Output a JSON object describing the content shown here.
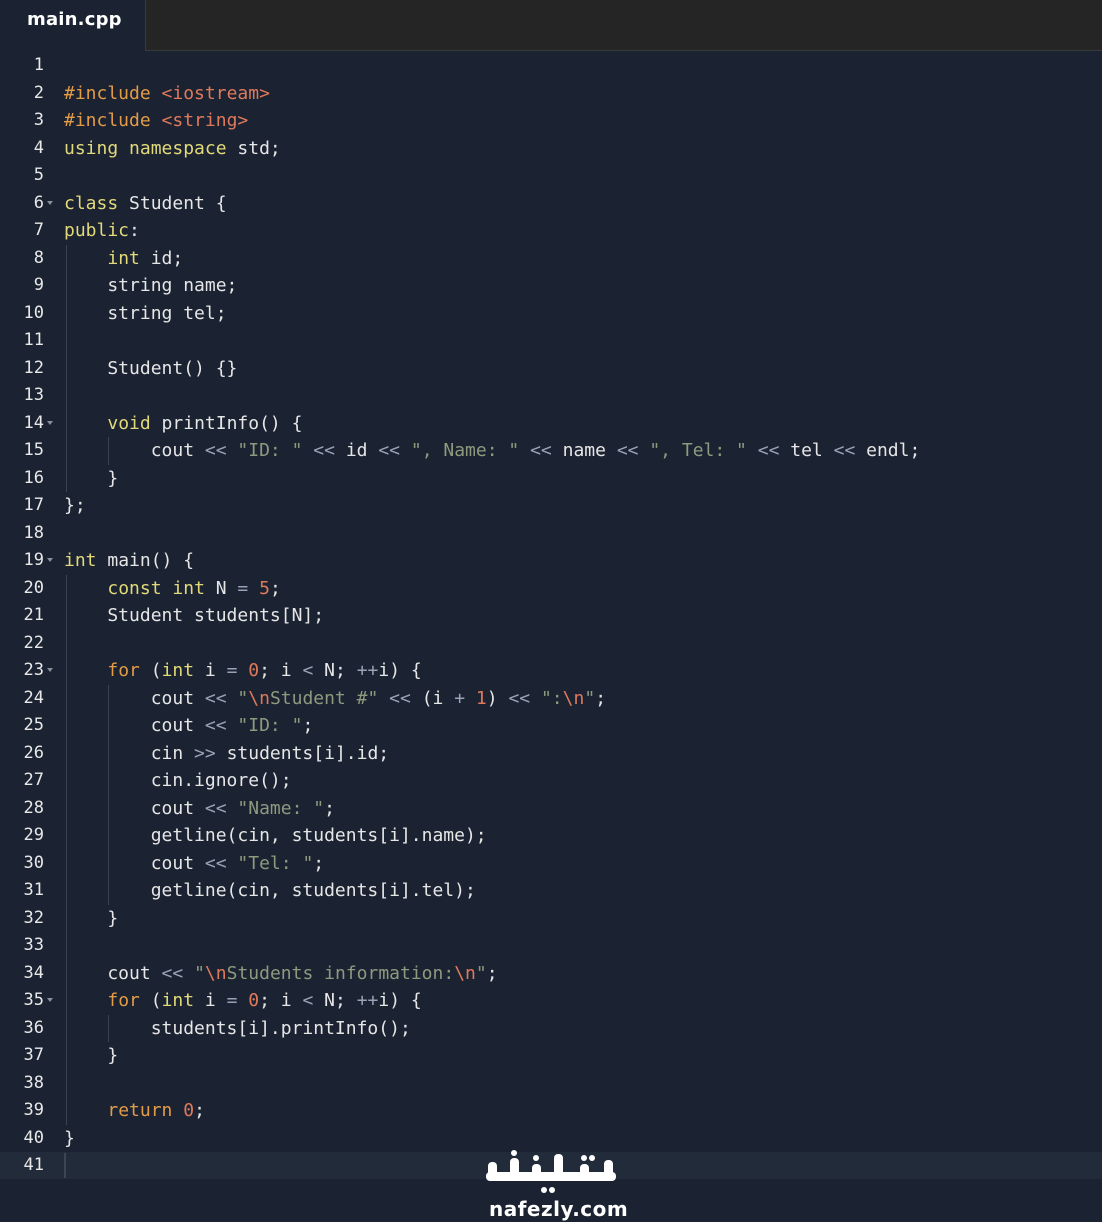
{
  "tab": {
    "filename": "main.cpp"
  },
  "editor": {
    "cursor_line": 41,
    "lines": [
      {
        "n": "1",
        "fold": false,
        "tokens": []
      },
      {
        "n": "2",
        "fold": false,
        "tokens": [
          {
            "c": "inc",
            "t": "#include"
          },
          {
            "c": "id",
            "t": " "
          },
          {
            "c": "hdr",
            "t": "<iostream>"
          }
        ]
      },
      {
        "n": "3",
        "fold": false,
        "tokens": [
          {
            "c": "inc",
            "t": "#include"
          },
          {
            "c": "id",
            "t": " "
          },
          {
            "c": "hdr",
            "t": "<string>"
          }
        ]
      },
      {
        "n": "4",
        "fold": false,
        "tokens": [
          {
            "c": "kw",
            "t": "using"
          },
          {
            "c": "id",
            "t": " "
          },
          {
            "c": "kw",
            "t": "namespace"
          },
          {
            "c": "id",
            "t": " std;"
          }
        ]
      },
      {
        "n": "5",
        "fold": false,
        "tokens": []
      },
      {
        "n": "6",
        "fold": true,
        "tokens": [
          {
            "c": "kw",
            "t": "class"
          },
          {
            "c": "id",
            "t": " Student {"
          }
        ]
      },
      {
        "n": "7",
        "fold": false,
        "tokens": [
          {
            "c": "kw",
            "t": "public"
          },
          {
            "c": "id",
            "t": ":"
          }
        ]
      },
      {
        "n": "8",
        "fold": false,
        "tokens": [
          {
            "c": "id",
            "t": "    "
          },
          {
            "c": "kw",
            "t": "int"
          },
          {
            "c": "id",
            "t": " id;"
          }
        ]
      },
      {
        "n": "9",
        "fold": false,
        "tokens": [
          {
            "c": "id",
            "t": "    string name;"
          }
        ]
      },
      {
        "n": "10",
        "fold": false,
        "tokens": [
          {
            "c": "id",
            "t": "    string tel;"
          }
        ]
      },
      {
        "n": "11",
        "fold": false,
        "tokens": []
      },
      {
        "n": "12",
        "fold": false,
        "tokens": [
          {
            "c": "id",
            "t": "    Student() {}"
          }
        ]
      },
      {
        "n": "13",
        "fold": false,
        "tokens": []
      },
      {
        "n": "14",
        "fold": true,
        "tokens": [
          {
            "c": "id",
            "t": "    "
          },
          {
            "c": "kw",
            "t": "void"
          },
          {
            "c": "id",
            "t": " printInfo() {"
          }
        ]
      },
      {
        "n": "15",
        "fold": false,
        "tokens": [
          {
            "c": "id",
            "t": "        cout "
          },
          {
            "c": "op",
            "t": "<<"
          },
          {
            "c": "id",
            "t": " "
          },
          {
            "c": "str",
            "t": "\"ID: \""
          },
          {
            "c": "id",
            "t": " "
          },
          {
            "c": "op",
            "t": "<<"
          },
          {
            "c": "id",
            "t": " id "
          },
          {
            "c": "op",
            "t": "<<"
          },
          {
            "c": "id",
            "t": " "
          },
          {
            "c": "str",
            "t": "\", Name: \""
          },
          {
            "c": "id",
            "t": " "
          },
          {
            "c": "op",
            "t": "<<"
          },
          {
            "c": "id",
            "t": " name "
          },
          {
            "c": "op",
            "t": "<<"
          },
          {
            "c": "id",
            "t": " "
          },
          {
            "c": "str",
            "t": "\", Tel: \""
          },
          {
            "c": "id",
            "t": " "
          },
          {
            "c": "op",
            "t": "<<"
          },
          {
            "c": "id",
            "t": " tel "
          },
          {
            "c": "op",
            "t": "<<"
          },
          {
            "c": "id",
            "t": " endl;"
          }
        ]
      },
      {
        "n": "16",
        "fold": false,
        "tokens": [
          {
            "c": "id",
            "t": "    }"
          }
        ]
      },
      {
        "n": "17",
        "fold": false,
        "tokens": [
          {
            "c": "id",
            "t": "};"
          }
        ]
      },
      {
        "n": "18",
        "fold": false,
        "tokens": []
      },
      {
        "n": "19",
        "fold": true,
        "tokens": [
          {
            "c": "kw",
            "t": "int"
          },
          {
            "c": "id",
            "t": " main() {"
          }
        ]
      },
      {
        "n": "20",
        "fold": false,
        "tokens": [
          {
            "c": "id",
            "t": "    "
          },
          {
            "c": "kw",
            "t": "const"
          },
          {
            "c": "id",
            "t": " "
          },
          {
            "c": "kw",
            "t": "int"
          },
          {
            "c": "id",
            "t": " N "
          },
          {
            "c": "op",
            "t": "="
          },
          {
            "c": "id",
            "t": " "
          },
          {
            "c": "num",
            "t": "5"
          },
          {
            "c": "id",
            "t": ";"
          }
        ]
      },
      {
        "n": "21",
        "fold": false,
        "tokens": [
          {
            "c": "id",
            "t": "    Student students[N];"
          }
        ]
      },
      {
        "n": "22",
        "fold": false,
        "tokens": []
      },
      {
        "n": "23",
        "fold": true,
        "tokens": [
          {
            "c": "id",
            "t": "    "
          },
          {
            "c": "ctl",
            "t": "for"
          },
          {
            "c": "id",
            "t": " ("
          },
          {
            "c": "kw",
            "t": "int"
          },
          {
            "c": "id",
            "t": " i "
          },
          {
            "c": "op",
            "t": "="
          },
          {
            "c": "id",
            "t": " "
          },
          {
            "c": "num",
            "t": "0"
          },
          {
            "c": "id",
            "t": "; i "
          },
          {
            "c": "op",
            "t": "<"
          },
          {
            "c": "id",
            "t": " N; "
          },
          {
            "c": "op",
            "t": "++"
          },
          {
            "c": "id",
            "t": "i) {"
          }
        ]
      },
      {
        "n": "24",
        "fold": false,
        "tokens": [
          {
            "c": "id",
            "t": "        cout "
          },
          {
            "c": "op",
            "t": "<<"
          },
          {
            "c": "id",
            "t": " "
          },
          {
            "c": "str",
            "t": "\""
          },
          {
            "c": "esc",
            "t": "\\n"
          },
          {
            "c": "str",
            "t": "Student #\""
          },
          {
            "c": "id",
            "t": " "
          },
          {
            "c": "op",
            "t": "<<"
          },
          {
            "c": "id",
            "t": " (i "
          },
          {
            "c": "op",
            "t": "+"
          },
          {
            "c": "id",
            "t": " "
          },
          {
            "c": "num",
            "t": "1"
          },
          {
            "c": "id",
            "t": ") "
          },
          {
            "c": "op",
            "t": "<<"
          },
          {
            "c": "id",
            "t": " "
          },
          {
            "c": "str",
            "t": "\":"
          },
          {
            "c": "esc",
            "t": "\\n"
          },
          {
            "c": "str",
            "t": "\""
          },
          {
            "c": "id",
            "t": ";"
          }
        ]
      },
      {
        "n": "25",
        "fold": false,
        "tokens": [
          {
            "c": "id",
            "t": "        cout "
          },
          {
            "c": "op",
            "t": "<<"
          },
          {
            "c": "id",
            "t": " "
          },
          {
            "c": "str",
            "t": "\"ID: \""
          },
          {
            "c": "id",
            "t": ";"
          }
        ]
      },
      {
        "n": "26",
        "fold": false,
        "tokens": [
          {
            "c": "id",
            "t": "        cin "
          },
          {
            "c": "op",
            "t": ">>"
          },
          {
            "c": "id",
            "t": " students[i].id;"
          }
        ]
      },
      {
        "n": "27",
        "fold": false,
        "tokens": [
          {
            "c": "id",
            "t": "        cin.ignore();"
          }
        ]
      },
      {
        "n": "28",
        "fold": false,
        "tokens": [
          {
            "c": "id",
            "t": "        cout "
          },
          {
            "c": "op",
            "t": "<<"
          },
          {
            "c": "id",
            "t": " "
          },
          {
            "c": "str",
            "t": "\"Name: \""
          },
          {
            "c": "id",
            "t": ";"
          }
        ]
      },
      {
        "n": "29",
        "fold": false,
        "tokens": [
          {
            "c": "id",
            "t": "        getline(cin, students[i].name);"
          }
        ]
      },
      {
        "n": "30",
        "fold": false,
        "tokens": [
          {
            "c": "id",
            "t": "        cout "
          },
          {
            "c": "op",
            "t": "<<"
          },
          {
            "c": "id",
            "t": " "
          },
          {
            "c": "str",
            "t": "\"Tel: \""
          },
          {
            "c": "id",
            "t": ";"
          }
        ]
      },
      {
        "n": "31",
        "fold": false,
        "tokens": [
          {
            "c": "id",
            "t": "        getline(cin, students[i].tel);"
          }
        ]
      },
      {
        "n": "32",
        "fold": false,
        "tokens": [
          {
            "c": "id",
            "t": "    }"
          }
        ]
      },
      {
        "n": "33",
        "fold": false,
        "tokens": []
      },
      {
        "n": "34",
        "fold": false,
        "tokens": [
          {
            "c": "id",
            "t": "    cout "
          },
          {
            "c": "op",
            "t": "<<"
          },
          {
            "c": "id",
            "t": " "
          },
          {
            "c": "str",
            "t": "\""
          },
          {
            "c": "esc",
            "t": "\\n"
          },
          {
            "c": "str",
            "t": "Students information:"
          },
          {
            "c": "esc",
            "t": "\\n"
          },
          {
            "c": "str",
            "t": "\""
          },
          {
            "c": "id",
            "t": ";"
          }
        ]
      },
      {
        "n": "35",
        "fold": true,
        "tokens": [
          {
            "c": "id",
            "t": "    "
          },
          {
            "c": "ctl",
            "t": "for"
          },
          {
            "c": "id",
            "t": " ("
          },
          {
            "c": "kw",
            "t": "int"
          },
          {
            "c": "id",
            "t": " i "
          },
          {
            "c": "op",
            "t": "="
          },
          {
            "c": "id",
            "t": " "
          },
          {
            "c": "num",
            "t": "0"
          },
          {
            "c": "id",
            "t": "; i "
          },
          {
            "c": "op",
            "t": "<"
          },
          {
            "c": "id",
            "t": " N; "
          },
          {
            "c": "op",
            "t": "++"
          },
          {
            "c": "id",
            "t": "i) {"
          }
        ]
      },
      {
        "n": "36",
        "fold": false,
        "tokens": [
          {
            "c": "id",
            "t": "        students[i].printInfo();"
          }
        ]
      },
      {
        "n": "37",
        "fold": false,
        "tokens": [
          {
            "c": "id",
            "t": "    }"
          }
        ]
      },
      {
        "n": "38",
        "fold": false,
        "tokens": []
      },
      {
        "n": "39",
        "fold": false,
        "tokens": [
          {
            "c": "id",
            "t": "    "
          },
          {
            "c": "ctl",
            "t": "return"
          },
          {
            "c": "id",
            "t": " "
          },
          {
            "c": "num",
            "t": "0"
          },
          {
            "c": "id",
            "t": ";"
          }
        ]
      },
      {
        "n": "40",
        "fold": false,
        "tokens": [
          {
            "c": "id",
            "t": "}"
          }
        ]
      },
      {
        "n": "41",
        "fold": false,
        "tokens": []
      }
    ]
  },
  "watermark": {
    "arabic": "نفذلي",
    "latin": "nafezly.com"
  },
  "colors": {
    "background": "#1b2332",
    "tabbar": "#252525",
    "keyword": "#e2d97a",
    "control": "#e49b46",
    "string": "#8e9a7e",
    "number": "#e0795b",
    "text": "#e6e6e6"
  },
  "icons": {
    "fold": "fold-arrow-icon",
    "watermark_logo": "nafezly-logo-icon"
  }
}
